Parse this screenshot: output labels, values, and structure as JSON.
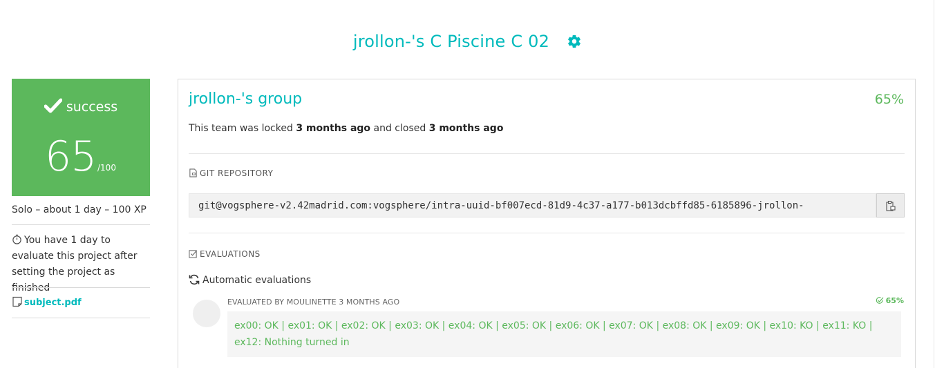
{
  "page": {
    "title": "jrollon-'s C Piscine C 02"
  },
  "status": {
    "label": "success",
    "score": "65",
    "max": "/100"
  },
  "sidebar": {
    "summary": "Solo – about 1 day – 100 XP",
    "evaluate_note": "You have 1 day to evaluate this project after setting the project as finished",
    "subject_file": "subject.pdf"
  },
  "team": {
    "name": "jrollon-'s group",
    "percentage": "65%",
    "locked_prefix": "This team was locked ",
    "locked_time": "3 months ago",
    "closed_mid": " and closed ",
    "closed_time": "3 months ago"
  },
  "repository": {
    "heading": "GIT REPOSITORY",
    "url": "git@vogsphere-v2.42madrid.com:vogsphere/intra-uuid-bf007ecd-81d9-4c37-a177-b013dcbffd85-6185896-jrollon-"
  },
  "evaluations": {
    "heading": "EVALUATIONS",
    "automatic_label": "Automatic evaluations",
    "entry": {
      "evaluator": "EVALUATED BY MOULINETTE 3 MONTHS AGO",
      "percentage": "65%",
      "result": "ex00: OK | ex01: OK | ex02: OK | ex03: OK | ex04: OK | ex05: OK | ex06: OK | ex07: OK | ex08: OK | ex09: OK | ex10: KO | ex11: KO | ex12: Nothing turned in"
    }
  },
  "colors": {
    "accent": "#00babc",
    "success": "#5cb85c"
  },
  "icons": [
    "gear-icon",
    "checkmark-icon",
    "stopwatch-icon",
    "file-icon",
    "git-icon",
    "clipboard-icon",
    "checkbox-icon",
    "refresh-icon",
    "check-circle-icon"
  ]
}
